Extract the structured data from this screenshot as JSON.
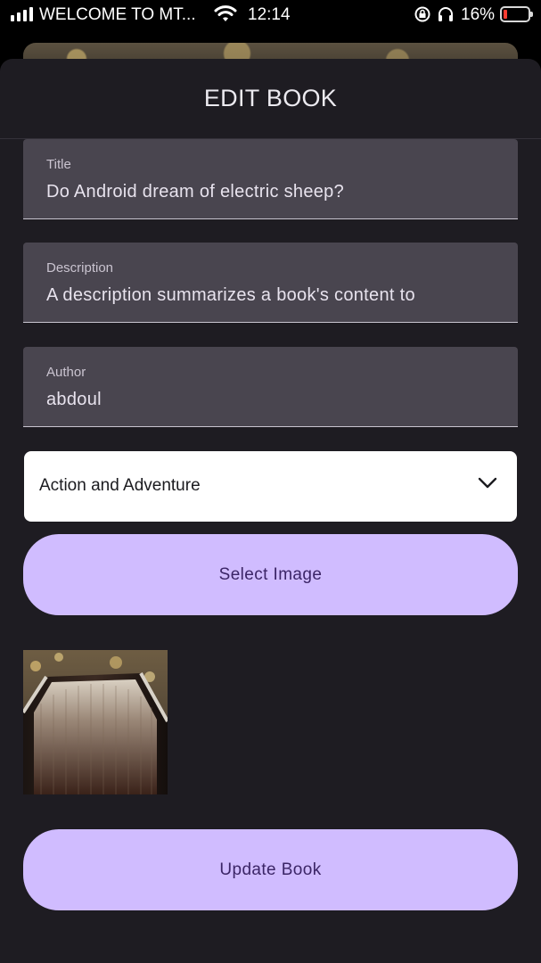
{
  "status_bar": {
    "carrier": "WELCOME TO MT...",
    "time": "12:14",
    "battery_percent": "16%",
    "battery_level": 0.16,
    "icons": [
      "signal-icon",
      "wifi-icon",
      "orientation-lock-icon",
      "headphones-icon",
      "battery-icon"
    ]
  },
  "sheet": {
    "title": "EDIT BOOK"
  },
  "form": {
    "title": {
      "label": "Title",
      "value": "Do Android dream of electric sheep?"
    },
    "description": {
      "label": "Description",
      "value": "A description summarizes a book's content to"
    },
    "author": {
      "label": "Author",
      "value": "abdoul"
    },
    "genre": {
      "selected": "Action and Adventure"
    },
    "select_image_label": "Select Image",
    "update_label": "Update Book"
  },
  "colors": {
    "sheet_bg": "#1e1c22",
    "field_bg": "#49454f",
    "button_bg": "#d0bcff",
    "button_text": "#3b2566"
  }
}
